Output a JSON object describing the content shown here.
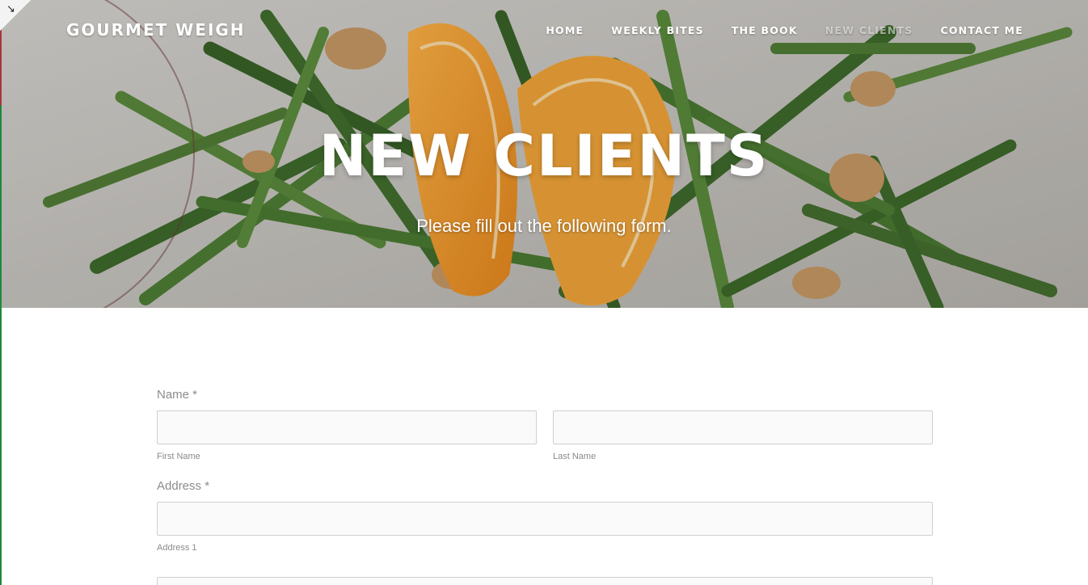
{
  "site": {
    "title": "GOURMET WEIGH"
  },
  "nav": {
    "items": [
      {
        "label": "HOME",
        "active": false
      },
      {
        "label": "WEEKLY BITES",
        "active": false
      },
      {
        "label": "THE BOOK",
        "active": false
      },
      {
        "label": "NEW CLIENTS",
        "active": true
      },
      {
        "label": "CONTACT ME",
        "active": false
      }
    ]
  },
  "hero": {
    "title": "NEW CLIENTS",
    "subtitle": "Please fill out the following form."
  },
  "form": {
    "name": {
      "label": "Name *",
      "first_value": "",
      "last_value": "",
      "first_sublabel": "First Name",
      "last_sublabel": "Last Name"
    },
    "address": {
      "label": "Address *",
      "line1_value": "",
      "line1_sublabel": "Address 1",
      "line2_value": ""
    }
  },
  "colors": {
    "hero_text": "#ffffff",
    "nav_active": "#ffffff8c",
    "label_gray": "#8c8c8c",
    "input_bg": "#fafafa",
    "input_border": "#cfcfcf"
  },
  "icons": {
    "corner": "expand-arrow-icon"
  }
}
